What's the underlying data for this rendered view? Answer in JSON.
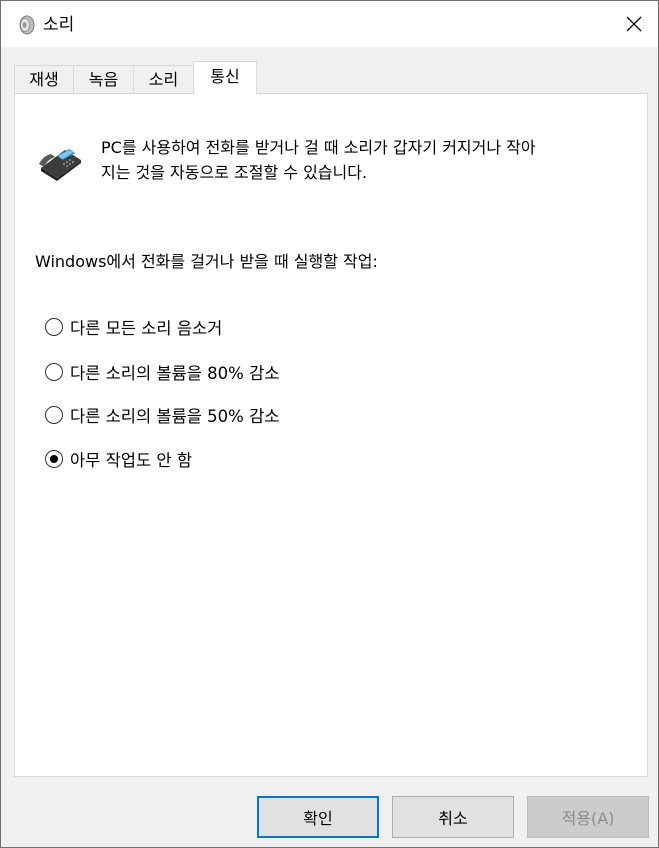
{
  "window": {
    "title": "소리",
    "title_icon": "speaker-icon",
    "close_icon": "close-icon"
  },
  "tabs": [
    {
      "label": "재생",
      "active": false
    },
    {
      "label": "녹음",
      "active": false
    },
    {
      "label": "소리",
      "active": false
    },
    {
      "label": "통신",
      "active": true
    }
  ],
  "communications": {
    "icon": "telephone-icon",
    "description_line1": "PC를 사용하여 전화를 받거나 걸 때 소리가 갑자기 커지거나 작아",
    "description_line2": "지는 것을 자동으로 조절할 수 있습니다.",
    "prompt": "Windows에서 전화를 걸거나 받을 때 실행할 작업:",
    "options": [
      {
        "label": "다른 모든 소리 음소거",
        "checked": false
      },
      {
        "label": "다른 소리의 볼륨을 80% 감소",
        "checked": false
      },
      {
        "label": "다른 소리의 볼륨을 50% 감소",
        "checked": false
      },
      {
        "label": "아무 작업도 안 함",
        "checked": true
      }
    ]
  },
  "buttons": {
    "ok": "확인",
    "cancel": "취소",
    "apply": "적용(A)"
  }
}
